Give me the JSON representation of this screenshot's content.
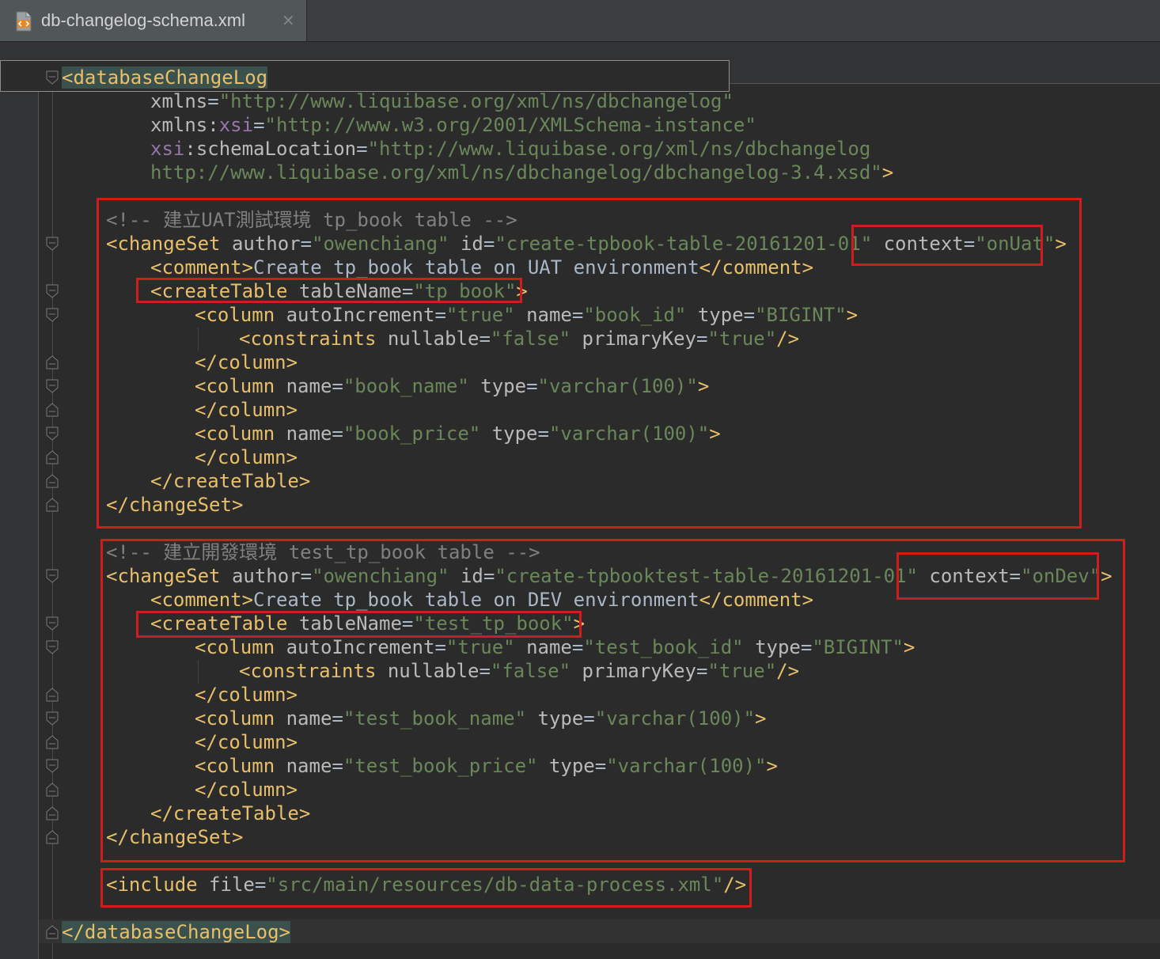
{
  "tab": {
    "icon": "xml-file-icon",
    "title": "db-changelog-schema.xml",
    "close_symbol": "×"
  },
  "code": {
    "root_open": "<databaseChangeLog",
    "xmlns_attr": "xmlns",
    "xmlns_value": "\"http://www.liquibase.org/xml/ns/dbchangelog\"",
    "xmlns_xsi_ns": "xmlns",
    "xsi_prefix": "xsi",
    "xmlns_xsi_value": "\"http://www.w3.org/2001/XMLSchema-instance\"",
    "schema_location_attr": "schemaLocation",
    "schema_location_value_1": "\"http://www.liquibase.org/xml/ns/dbchangelog",
    "schema_location_value_2": "http://www.liquibase.org/xml/ns/dbchangelog/dbchangelog-3.4.xsd\"",
    "uat": {
      "comment": "<!-- 建立UAT測試環境 tp_book table -->",
      "author": "\"owenchiang\"",
      "id": "\"create-tpbook-table-20161201-01\"",
      "context": "\"onUat\"",
      "comment_text": "Create tp_book table on UAT environment",
      "table_name": "\"tp_book\"",
      "col1_auto": "\"true\"",
      "col1_name": "\"book_id\"",
      "col1_type": "\"BIGINT\"",
      "nullable": "\"false\"",
      "primary_key": "\"true\"",
      "col2_name": "\"book_name\"",
      "col2_type": "\"varchar(100)\"",
      "col3_name": "\"book_price\"",
      "col3_type": "\"varchar(100)\""
    },
    "dev": {
      "comment": "<!-- 建立開發環境 test_tp_book table -->",
      "author": "\"owenchiang\"",
      "id": "\"create-tpbooktest-table-20161201-01\"",
      "context": "\"onDev\"",
      "comment_text": "Create tp_book table on DEV environment",
      "table_name": "\"test_tp_book\"",
      "col1_auto": "\"true\"",
      "col1_name": "\"test_book_id\"",
      "col1_type": "\"BIGINT\"",
      "nullable": "\"false\"",
      "primary_key": "\"true\"",
      "col2_name": "\"test_book_name\"",
      "col2_type": "\"varchar(100)\"",
      "col3_name": "\"test_book_price\"",
      "col3_type": "\"varchar(100)\""
    },
    "include_file": "\"src/main/resources/db-data-process.xml\"",
    "root_close": "</databaseChangeLog>"
  },
  "colors": {
    "background": "#2b2b2b",
    "tag": "#e8bf6a",
    "attribute": "#bababa",
    "value": "#6a8759",
    "namespace": "#9876aa",
    "comment": "#808080",
    "highlight_box": "#d01c1c"
  }
}
